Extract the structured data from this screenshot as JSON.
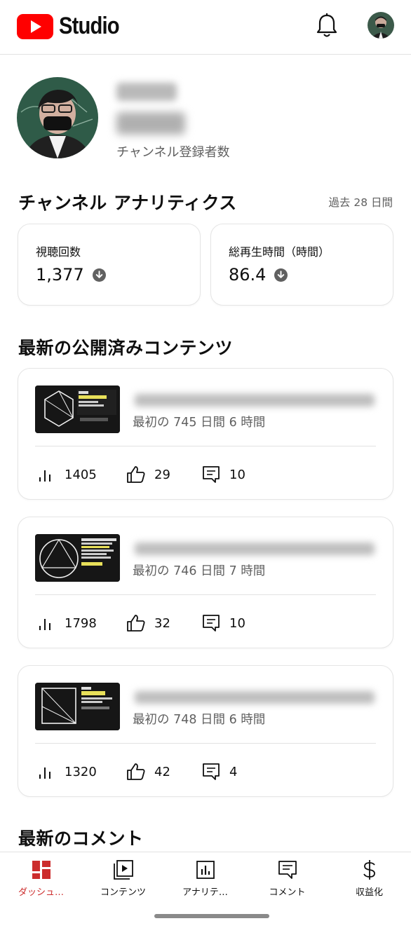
{
  "app": {
    "title": "Studio",
    "brand_color": "#ff0000"
  },
  "header": {
    "icons": [
      "youtube-logo",
      "bell-icon",
      "account-avatar"
    ]
  },
  "channel": {
    "subscribers_label": "チャンネル登録者数"
  },
  "analytics": {
    "title": "チャンネル アナリティクス",
    "period": "過去 28 日間",
    "cards": [
      {
        "label": "視聴回数",
        "value": "1,377",
        "trend": "down"
      },
      {
        "label": "総再生時間（時間）",
        "value": "86.4",
        "trend": "down"
      }
    ]
  },
  "content": {
    "title": "最新の公開済みコンテンツ",
    "items": [
      {
        "since": "最初の 745 日間 6 時間",
        "views": "1405",
        "likes": "29",
        "comments": "10"
      },
      {
        "since": "最初の 746 日間 7 時間",
        "views": "1798",
        "likes": "32",
        "comments": "10"
      },
      {
        "since": "最初の 748 日間 6 時間",
        "views": "1320",
        "likes": "42",
        "comments": "4"
      }
    ]
  },
  "comments": {
    "title": "最新のコメント"
  },
  "nav": {
    "active_color": "#cc2d2d",
    "items": [
      {
        "label": "ダッシュ…",
        "icon": "dashboard-icon",
        "active": true
      },
      {
        "label": "コンテンツ",
        "icon": "content-icon",
        "active": false
      },
      {
        "label": "アナリテ…",
        "icon": "analytics-icon",
        "active": false
      },
      {
        "label": "コメント",
        "icon": "comment-icon",
        "active": false
      },
      {
        "label": "収益化",
        "icon": "monetization-icon",
        "active": false
      }
    ]
  }
}
